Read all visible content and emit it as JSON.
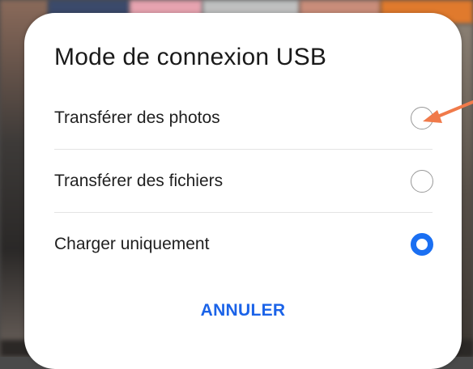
{
  "dialog": {
    "title": "Mode de connexion USB",
    "options": [
      {
        "label": "Transférer des photos",
        "selected": false
      },
      {
        "label": "Transférer des fichiers",
        "selected": false
      },
      {
        "label": "Charger uniquement",
        "selected": true
      }
    ],
    "cancel_label": "ANNULER"
  },
  "colors": {
    "accent": "#1a6ff2",
    "annotation_arrow": "#f07a4a"
  },
  "icons": {
    "radio_unselected": "radio-unchecked-icon",
    "radio_selected": "radio-checked-icon",
    "annotation": "arrow-icon"
  }
}
